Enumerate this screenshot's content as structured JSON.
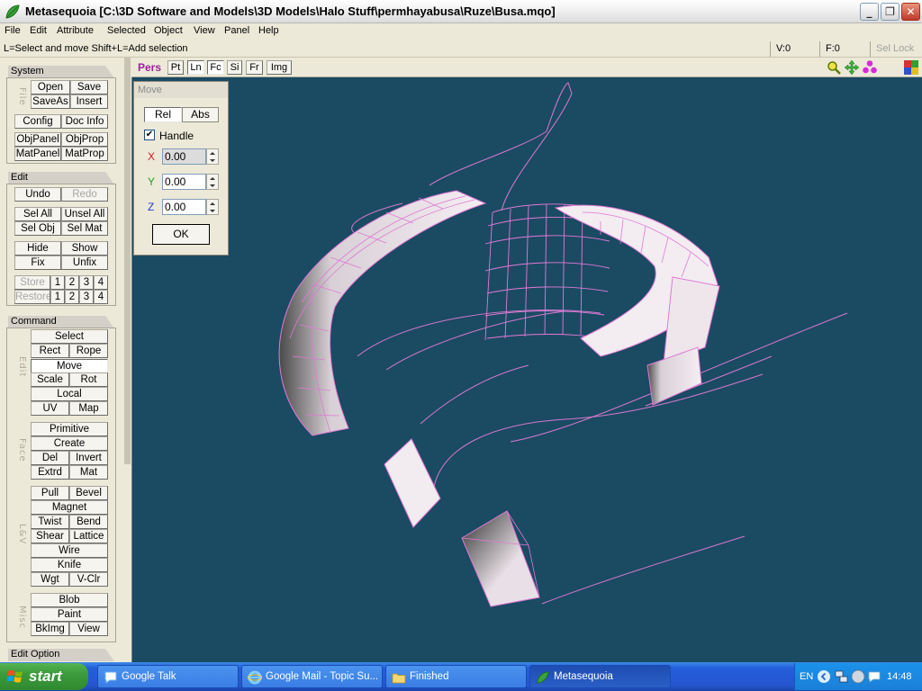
{
  "window": {
    "title": "Metasequoia [C:\\3D Software and Models\\3D Models\\Halo Stuff\\permhayabusa\\Ruze\\Busa.mqo]"
  },
  "menu": [
    "File",
    "Edit",
    "Attribute",
    "Selected",
    "Object",
    "View",
    "Panel",
    "Help"
  ],
  "status": {
    "hint": "L=Select and move  Shift+L=Add selection",
    "vertex": "V:0",
    "face": "F:0",
    "sel_lock": "Sel Lock"
  },
  "panel": {
    "system": {
      "title": "System",
      "group_label": "File",
      "buttons": [
        "Open",
        "Save",
        "SaveAs",
        "Insert",
        "Config",
        "Doc Info",
        "ObjPanel",
        "ObjProp",
        "MatPanel",
        "MatProp"
      ]
    },
    "edit": {
      "title": "Edit",
      "buttons": [
        "Undo",
        "Redo",
        "Sel All",
        "Unsel All",
        "Sel Obj",
        "Sel Mat",
        "Hide",
        "Show",
        "Fix",
        "Unfix",
        "Store",
        "Restore"
      ],
      "slots": [
        "1",
        "2",
        "3",
        "4"
      ]
    },
    "command": {
      "title": "Command",
      "groups": {
        "edit": {
          "label": "Edit",
          "buttons": [
            "Select",
            "Rect",
            "Rope",
            "Move",
            "Scale",
            "Rot",
            "Local",
            "UV",
            "Map"
          ]
        },
        "face": {
          "label": "Face",
          "buttons": [
            "Primitive",
            "Create",
            "Del",
            "Invert",
            "Extrd",
            "Mat"
          ]
        },
        "lv": {
          "label": "L&V",
          "buttons": [
            "Pull",
            "Bevel",
            "Magnet",
            "Twist",
            "Bend",
            "Shear",
            "Lattice",
            "Wire",
            "Knife",
            "Wgt",
            "V-Clr"
          ]
        },
        "misc": {
          "label": "Misc",
          "buttons": [
            "Blob",
            "Paint",
            "BkImg",
            "View"
          ]
        }
      }
    },
    "edit_option": {
      "title": "Edit Option"
    }
  },
  "viewport": {
    "mode": "Pers",
    "toggles": [
      "Pt",
      "Ln",
      "Fc",
      "Si",
      "Fr",
      "Img"
    ],
    "icons": [
      "zoom-icon",
      "move-view-icon",
      "rotate-view-icon",
      "grid-icon"
    ],
    "colors": {
      "background": "#1b4a63",
      "wire": "#e070d0",
      "surface": "#f0e8ee"
    }
  },
  "move_dialog": {
    "title": "Move",
    "tabs": [
      "Rel",
      "Abs"
    ],
    "handle_label": "Handle",
    "handle_checked": "✔",
    "x_label": "X",
    "x_value": "0.00",
    "y_label": "Y",
    "y_value": "0.00",
    "z_label": "Z",
    "z_value": "0.00",
    "ok_label": "OK"
  },
  "taskbar": {
    "start": "start",
    "tasks": [
      "Google Talk",
      "Google Mail - Topic Su...",
      "Finished",
      "Metasequoia"
    ],
    "language": "EN",
    "clock": "14:48"
  }
}
